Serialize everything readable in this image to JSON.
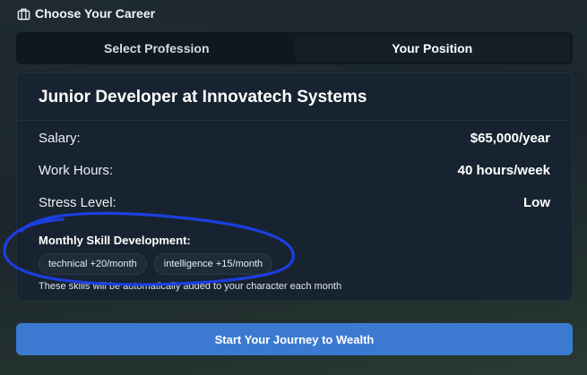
{
  "header": {
    "title": "Choose Your Career",
    "icon": "briefcase-icon"
  },
  "tabs": [
    {
      "label": "Select Profession",
      "active": false
    },
    {
      "label": "Your Position",
      "active": true
    }
  ],
  "position": {
    "title": "Junior Developer at Innovatech Systems",
    "details": [
      {
        "label": "Salary:",
        "value": "$65,000/year"
      },
      {
        "label": "Work Hours:",
        "value": "40 hours/week"
      },
      {
        "label": "Stress Level:",
        "value": "Low"
      }
    ],
    "skills_title": "Monthly Skill Development:",
    "skills": [
      "technical +20/month",
      "intelligence +15/month"
    ],
    "skills_note": "These skills will be automatically added to your character each month"
  },
  "cta": {
    "label": "Start Your Journey to Wealth"
  },
  "colors": {
    "accent": "#3b7ad0",
    "card_bg": "#172330",
    "annotation": "#1c3fe0"
  }
}
